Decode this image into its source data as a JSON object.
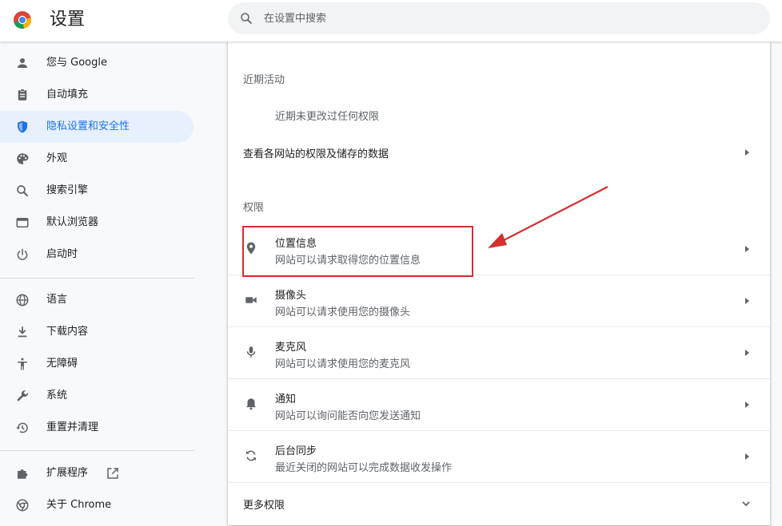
{
  "header": {
    "title": "设置",
    "search_placeholder": "在设置中搜索"
  },
  "sidebar": {
    "items": [
      {
        "label": "您与 Google",
        "icon": "person-icon"
      },
      {
        "label": "自动填充",
        "icon": "clipboard-icon"
      },
      {
        "label": "隐私设置和安全性",
        "icon": "shield-icon",
        "active": true
      },
      {
        "label": "外观",
        "icon": "palette-icon"
      },
      {
        "label": "搜索引擎",
        "icon": "search-icon"
      },
      {
        "label": "默认浏览器",
        "icon": "browser-window-icon"
      },
      {
        "label": "启动时",
        "icon": "power-icon"
      },
      {
        "label": "语言",
        "icon": "globe-icon"
      },
      {
        "label": "下载内容",
        "icon": "download-icon"
      },
      {
        "label": "无障碍",
        "icon": "accessibility-icon"
      },
      {
        "label": "系统",
        "icon": "wrench-icon"
      },
      {
        "label": "重置并清理",
        "icon": "history-icon"
      },
      {
        "label": "扩展程序",
        "icon": "puzzle-icon"
      },
      {
        "label": "关于 Chrome",
        "icon": "chrome-icon"
      }
    ]
  },
  "main": {
    "recent_activity_heading": "近期活动",
    "recent_activity_empty": "近期未更改过任何权限",
    "view_site_data": "查看各网站的权限及储存的数据",
    "permissions_heading": "权限",
    "permissions": [
      {
        "title": "位置信息",
        "subtitle": "网站可以请求取得您的位置信息",
        "icon": "location-pin-icon"
      },
      {
        "title": "摄像头",
        "subtitle": "网站可以请求使用您的摄像头",
        "icon": "camera-icon"
      },
      {
        "title": "麦克风",
        "subtitle": "网站可以请求使用您的麦克风",
        "icon": "microphone-icon"
      },
      {
        "title": "通知",
        "subtitle": "网站可以询问能否向您发送通知",
        "icon": "bell-icon"
      },
      {
        "title": "后台同步",
        "subtitle": "最近关闭的网站可以完成数据收发操作",
        "icon": "sync-icon"
      }
    ],
    "more_permissions": "更多权限"
  },
  "colors": {
    "accent": "#1a73e8",
    "annotation": "#d32f2f"
  }
}
